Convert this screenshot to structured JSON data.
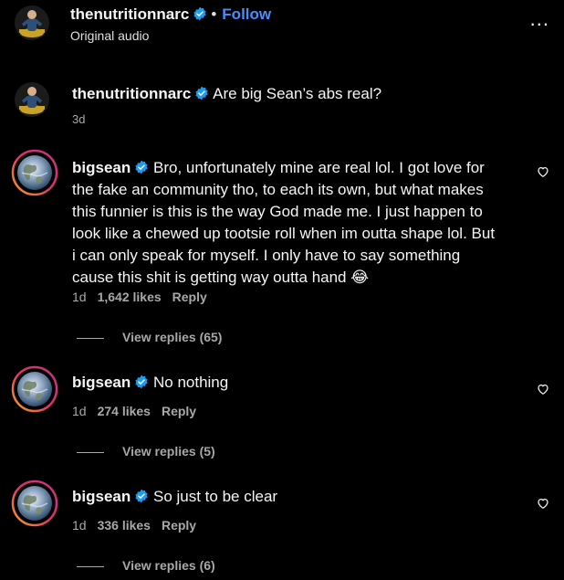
{
  "header": {
    "username": "thenutritionnarc",
    "separator": "•",
    "follow_label": "Follow",
    "audio": "Original audio",
    "more": "..."
  },
  "caption": {
    "username": "thenutritionnarc",
    "text": "Are big Sean’s abs real?",
    "time": "3d"
  },
  "comments": [
    {
      "username": "bigsean",
      "text": "Bro, unfortunately mine are real lol. I got love for the fake an community tho, to each its own, but what makes this funnier is this is the way God made me. I just happen to look like a chewed up tootsie roll when im outta shape lol. But i can only speak for myself. I only have to say something cause this shit is getting way outta hand 😂",
      "time": "1d",
      "likes": "1,642 likes",
      "reply": "Reply",
      "view_replies": "View replies (65)"
    },
    {
      "username": "bigsean",
      "text": "No nothing",
      "time": "1d",
      "likes": "274 likes",
      "reply": "Reply",
      "view_replies": "View replies (5)"
    },
    {
      "username": "bigsean",
      "text": "So just to be clear",
      "time": "1d",
      "likes": "336 likes",
      "reply": "Reply",
      "view_replies": "View replies (6)"
    }
  ],
  "colors": {
    "background": "#000000",
    "text": "#f5f5f5",
    "muted": "#a8a8a8",
    "follow": "#4a8df8",
    "verified": "#1d9bf0",
    "story_ring_start": "#c13584",
    "story_ring_end": "#f7a51c"
  },
  "icons": {
    "verified": "verified-badge-icon",
    "heart": "heart-outline-icon",
    "more": "more-options-icon"
  }
}
